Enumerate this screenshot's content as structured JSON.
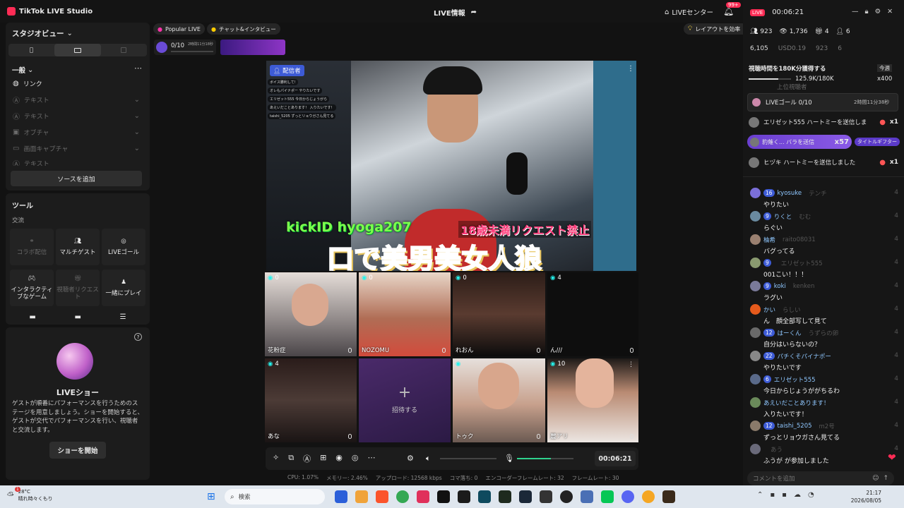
{
  "app": {
    "name": "TikTok LIVE Studio"
  },
  "header": {
    "center_title": "LIVE情報",
    "live_center": "LIVEセンター",
    "notif_badge": "99+"
  },
  "studio": {
    "view_label": "スタジオビュー"
  },
  "sources": {
    "section": "一般",
    "items": [
      "リンク",
      "テキスト",
      "テキスト",
      "オブチャ",
      "画面キャプチャ",
      "テキスト"
    ],
    "add_button": "ソースを追加"
  },
  "tools": {
    "title": "ツール",
    "subtitle": "交流",
    "tiles": [
      "コラボ配信",
      "マルチゲスト",
      "LIVEゴール",
      "インタラクティブなゲーム",
      "視聴者リクエスト",
      "一緒にプレイ"
    ]
  },
  "liveshow": {
    "title": "LIVEショー",
    "desc": "ゲストが順番にパフォーマンスを行うためのステージを用意しましょう。ショーを開始すると、ゲストが交代でパフォーマンスを行い、視聴者と交流します。",
    "button": "ショーを開始"
  },
  "chips": {
    "popular": "Popular LIVE",
    "chat": "チャット&インタビュー",
    "layout": "レイアウトを効率"
  },
  "goal_widget": {
    "count": "0/10",
    "time": "2時間11分18秒"
  },
  "stage": {
    "host_tag": "配信者",
    "overlay_kick": "kickID hyoga207",
    "overlay_rule": "18歳未満リクエスト禁止",
    "overlay_title": "口で美男美女人狼",
    "overlay_chat": [
      "ボイス勝利して!",
      "オレもパイナポー やりたいです",
      "エリゼット555 今日からじょうがら",
      "あえいだことあります！ 入りたいです！",
      "taishi_5205 ずっとリョウガさん見てる"
    ],
    "guests": [
      {
        "name": "花粉症",
        "count": "0"
      },
      {
        "name": "NOZOMU",
        "count": "0"
      },
      {
        "name": "れおん",
        "count": "0"
      },
      {
        "name": "ん///",
        "count": "4"
      },
      {
        "name": "あな",
        "count": "4"
      },
      {
        "name": "招待する",
        "count": ""
      },
      {
        "name": "トゥク",
        "count": ""
      },
      {
        "name": "麗アリ",
        "count": "10"
      }
    ],
    "timer": "00:06:21"
  },
  "status": {
    "cpu": "CPU: 1.07%",
    "memory": "メモリー: 2.46%",
    "upload": "アップロード: 12568 kbps",
    "dropped": "コマ落ち: 0",
    "encoder": "エンコーダーフレームレート: 32",
    "fps": "フレームレート: 30"
  },
  "right": {
    "live_label": "LIVE",
    "live_timer": "00:06:21",
    "stats1": [
      "923",
      "1,736",
      "4",
      "6"
    ],
    "stats2": [
      "6,105",
      "USD0.19",
      "923",
      "6"
    ],
    "watch_goal": "視聴時間を180K分獲得する",
    "watch_goal_progress": 0.7,
    "watch_goal_value": "125.9K/180K",
    "watch_goal_today": "今週",
    "watch_goal_reward": "x400",
    "top_viewers": "上位視聴者",
    "live_goal": "LIVEゴール 0/10",
    "live_goal_time": "2時間11分38秒",
    "gifts": [
      {
        "text": "エリゼット555 ハートミーを送信しま",
        "count": "x1"
      },
      {
        "text": "豹薙く...  バラを送信",
        "count": "x57",
        "tag": "タイトルギフター"
      },
      {
        "text": "ヒヅキ ハートミーを送信しました",
        "count": "x1"
      }
    ],
    "chat": [
      {
        "lv": "16",
        "user": "kyosuke",
        "msg": "やりたい",
        "ghost": "テンチ",
        "n": "4"
      },
      {
        "lv": "9",
        "user": "りくと",
        "msg": "らぐい",
        "ghost": "むむ",
        "n": "4"
      },
      {
        "lv": "",
        "user": "柚希",
        "msg": "バグってる",
        "ghost": "raito08031",
        "n": "4"
      },
      {
        "lv": "9",
        "user": "",
        "msg": "001こい！！！",
        "ghost": "エリゼット555",
        "n": "4"
      },
      {
        "lv": "9",
        "user": "koki",
        "msg": "ラグい",
        "ghost": "kenken",
        "n": "4"
      },
      {
        "lv": "",
        "user": "かい",
        "msg": "ん　顔全部写して見て",
        "ghost": "らしい",
        "n": "4"
      },
      {
        "lv": "12",
        "user": "はーくん",
        "msg": "自分はいらないの？",
        "ghost": "うずらの卵",
        "n": "4"
      },
      {
        "lv": "22",
        "user": "パチくそパイナポー",
        "msg": "やりたいです",
        "ghost": "",
        "n": "4"
      },
      {
        "lv": "6",
        "user": "エリゼット555",
        "msg": "今日からじょうががちるわ",
        "ghost": "",
        "n": "4"
      },
      {
        "lv": "",
        "user": "あえいだことあります！",
        "msg": "入りたいです！",
        "ghost": "",
        "n": "4"
      },
      {
        "lv": "12",
        "user": "taishi_5205",
        "msg": "ずっとリョウガさん見てる",
        "ghost": "m2号",
        "n": "4"
      },
      {
        "lv": "",
        "user": "",
        "msg": "ふうが が参加しました",
        "ghost": "あう",
        "n": "4"
      }
    ],
    "comment_placeholder": "コメントを追加"
  },
  "taskbar": {
    "weather_temp": "28°C",
    "weather_desc": "晴れ時々くもり",
    "weather_badge": "1",
    "search": "検索",
    "time": "21:17",
    "date": "2026/08/05"
  },
  "colors": {
    "accent": "#fe2c55",
    "teal": "#25f4ee",
    "blue_badge": "#3d5bd6"
  }
}
